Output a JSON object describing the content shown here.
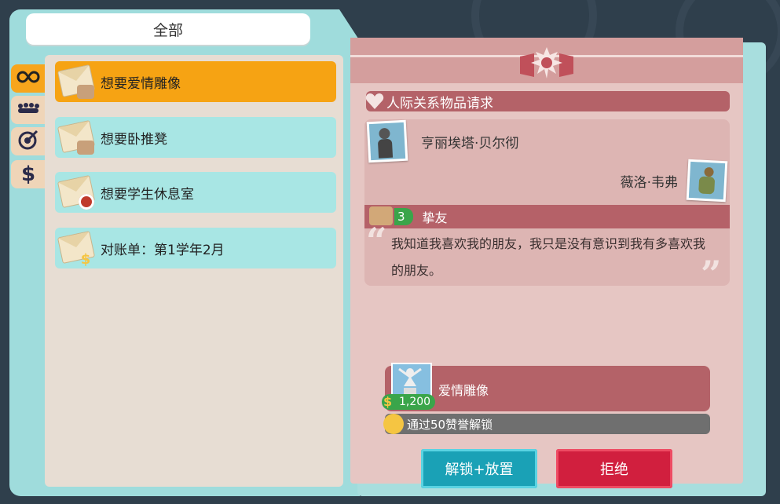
{
  "filter": {
    "label": "全部"
  },
  "side_tabs": [
    {
      "icon": "infinity-icon",
      "active": true
    },
    {
      "icon": "crowd-icon",
      "active": false
    },
    {
      "icon": "target-icon",
      "active": false
    },
    {
      "icon": "dollar-icon",
      "active": false
    }
  ],
  "requests": [
    {
      "label": "想要爱情雕像",
      "selected": true,
      "badge": "handshake"
    },
    {
      "label": "想要卧推凳",
      "selected": false,
      "badge": "handshake"
    },
    {
      "label": "想要学生休息室",
      "selected": false,
      "badge": "target"
    },
    {
      "label": "对账单：第1学年2月",
      "selected": false,
      "badge": "dollar"
    }
  ],
  "detail": {
    "section_title": "人际关系物品请求",
    "person_a": "亨丽埃塔·贝尔彻",
    "person_b": "薇洛·韦弗",
    "relationship": {
      "level": "3",
      "label": "挚友"
    },
    "quote": "我知道我喜欢我的朋友，我只是没有意识到我有多喜欢我的朋友。",
    "reward": {
      "name": "爱情雕像",
      "price": "1,200"
    },
    "unlock_text": "通过50赞誉解锁",
    "buttons": {
      "unlock_place": "解锁+放置",
      "reject": "拒绝"
    }
  },
  "colors": {
    "selected": "#f6a313",
    "item": "#a8e6e4",
    "accent_red": "#b46268",
    "unlock_btn": "#1aa1b6",
    "reject_btn": "#d11f3e"
  }
}
